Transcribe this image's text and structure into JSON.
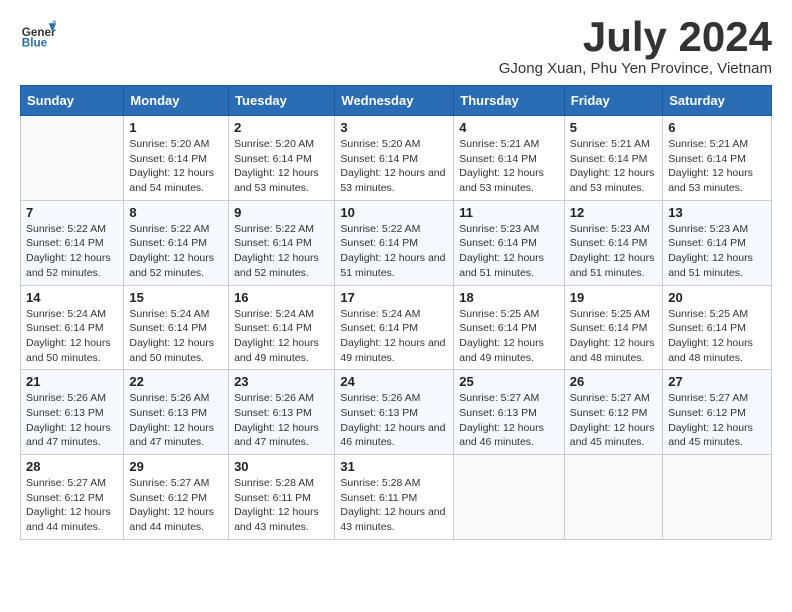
{
  "header": {
    "logo_line1": "General",
    "logo_line2": "Blue",
    "title": "July 2024",
    "subtitle": "GJong Xuan, Phu Yen Province, Vietnam"
  },
  "days_of_week": [
    "Sunday",
    "Monday",
    "Tuesday",
    "Wednesday",
    "Thursday",
    "Friday",
    "Saturday"
  ],
  "weeks": [
    [
      {
        "day": "",
        "info": ""
      },
      {
        "day": "1",
        "info": "Sunrise: 5:20 AM\nSunset: 6:14 PM\nDaylight: 12 hours and 54 minutes."
      },
      {
        "day": "2",
        "info": "Sunrise: 5:20 AM\nSunset: 6:14 PM\nDaylight: 12 hours and 53 minutes."
      },
      {
        "day": "3",
        "info": "Sunrise: 5:20 AM\nSunset: 6:14 PM\nDaylight: 12 hours and 53 minutes."
      },
      {
        "day": "4",
        "info": "Sunrise: 5:21 AM\nSunset: 6:14 PM\nDaylight: 12 hours and 53 minutes."
      },
      {
        "day": "5",
        "info": "Sunrise: 5:21 AM\nSunset: 6:14 PM\nDaylight: 12 hours and 53 minutes."
      },
      {
        "day": "6",
        "info": "Sunrise: 5:21 AM\nSunset: 6:14 PM\nDaylight: 12 hours and 53 minutes."
      }
    ],
    [
      {
        "day": "7",
        "info": "Sunrise: 5:22 AM\nSunset: 6:14 PM\nDaylight: 12 hours and 52 minutes."
      },
      {
        "day": "8",
        "info": "Sunrise: 5:22 AM\nSunset: 6:14 PM\nDaylight: 12 hours and 52 minutes."
      },
      {
        "day": "9",
        "info": "Sunrise: 5:22 AM\nSunset: 6:14 PM\nDaylight: 12 hours and 52 minutes."
      },
      {
        "day": "10",
        "info": "Sunrise: 5:22 AM\nSunset: 6:14 PM\nDaylight: 12 hours and 51 minutes."
      },
      {
        "day": "11",
        "info": "Sunrise: 5:23 AM\nSunset: 6:14 PM\nDaylight: 12 hours and 51 minutes."
      },
      {
        "day": "12",
        "info": "Sunrise: 5:23 AM\nSunset: 6:14 PM\nDaylight: 12 hours and 51 minutes."
      },
      {
        "day": "13",
        "info": "Sunrise: 5:23 AM\nSunset: 6:14 PM\nDaylight: 12 hours and 51 minutes."
      }
    ],
    [
      {
        "day": "14",
        "info": "Sunrise: 5:24 AM\nSunset: 6:14 PM\nDaylight: 12 hours and 50 minutes."
      },
      {
        "day": "15",
        "info": "Sunrise: 5:24 AM\nSunset: 6:14 PM\nDaylight: 12 hours and 50 minutes."
      },
      {
        "day": "16",
        "info": "Sunrise: 5:24 AM\nSunset: 6:14 PM\nDaylight: 12 hours and 49 minutes."
      },
      {
        "day": "17",
        "info": "Sunrise: 5:24 AM\nSunset: 6:14 PM\nDaylight: 12 hours and 49 minutes."
      },
      {
        "day": "18",
        "info": "Sunrise: 5:25 AM\nSunset: 6:14 PM\nDaylight: 12 hours and 49 minutes."
      },
      {
        "day": "19",
        "info": "Sunrise: 5:25 AM\nSunset: 6:14 PM\nDaylight: 12 hours and 48 minutes."
      },
      {
        "day": "20",
        "info": "Sunrise: 5:25 AM\nSunset: 6:14 PM\nDaylight: 12 hours and 48 minutes."
      }
    ],
    [
      {
        "day": "21",
        "info": "Sunrise: 5:26 AM\nSunset: 6:13 PM\nDaylight: 12 hours and 47 minutes."
      },
      {
        "day": "22",
        "info": "Sunrise: 5:26 AM\nSunset: 6:13 PM\nDaylight: 12 hours and 47 minutes."
      },
      {
        "day": "23",
        "info": "Sunrise: 5:26 AM\nSunset: 6:13 PM\nDaylight: 12 hours and 47 minutes."
      },
      {
        "day": "24",
        "info": "Sunrise: 5:26 AM\nSunset: 6:13 PM\nDaylight: 12 hours and 46 minutes."
      },
      {
        "day": "25",
        "info": "Sunrise: 5:27 AM\nSunset: 6:13 PM\nDaylight: 12 hours and 46 minutes."
      },
      {
        "day": "26",
        "info": "Sunrise: 5:27 AM\nSunset: 6:12 PM\nDaylight: 12 hours and 45 minutes."
      },
      {
        "day": "27",
        "info": "Sunrise: 5:27 AM\nSunset: 6:12 PM\nDaylight: 12 hours and 45 minutes."
      }
    ],
    [
      {
        "day": "28",
        "info": "Sunrise: 5:27 AM\nSunset: 6:12 PM\nDaylight: 12 hours and 44 minutes."
      },
      {
        "day": "29",
        "info": "Sunrise: 5:27 AM\nSunset: 6:12 PM\nDaylight: 12 hours and 44 minutes."
      },
      {
        "day": "30",
        "info": "Sunrise: 5:28 AM\nSunset: 6:11 PM\nDaylight: 12 hours and 43 minutes."
      },
      {
        "day": "31",
        "info": "Sunrise: 5:28 AM\nSunset: 6:11 PM\nDaylight: 12 hours and 43 minutes."
      },
      {
        "day": "",
        "info": ""
      },
      {
        "day": "",
        "info": ""
      },
      {
        "day": "",
        "info": ""
      }
    ]
  ]
}
